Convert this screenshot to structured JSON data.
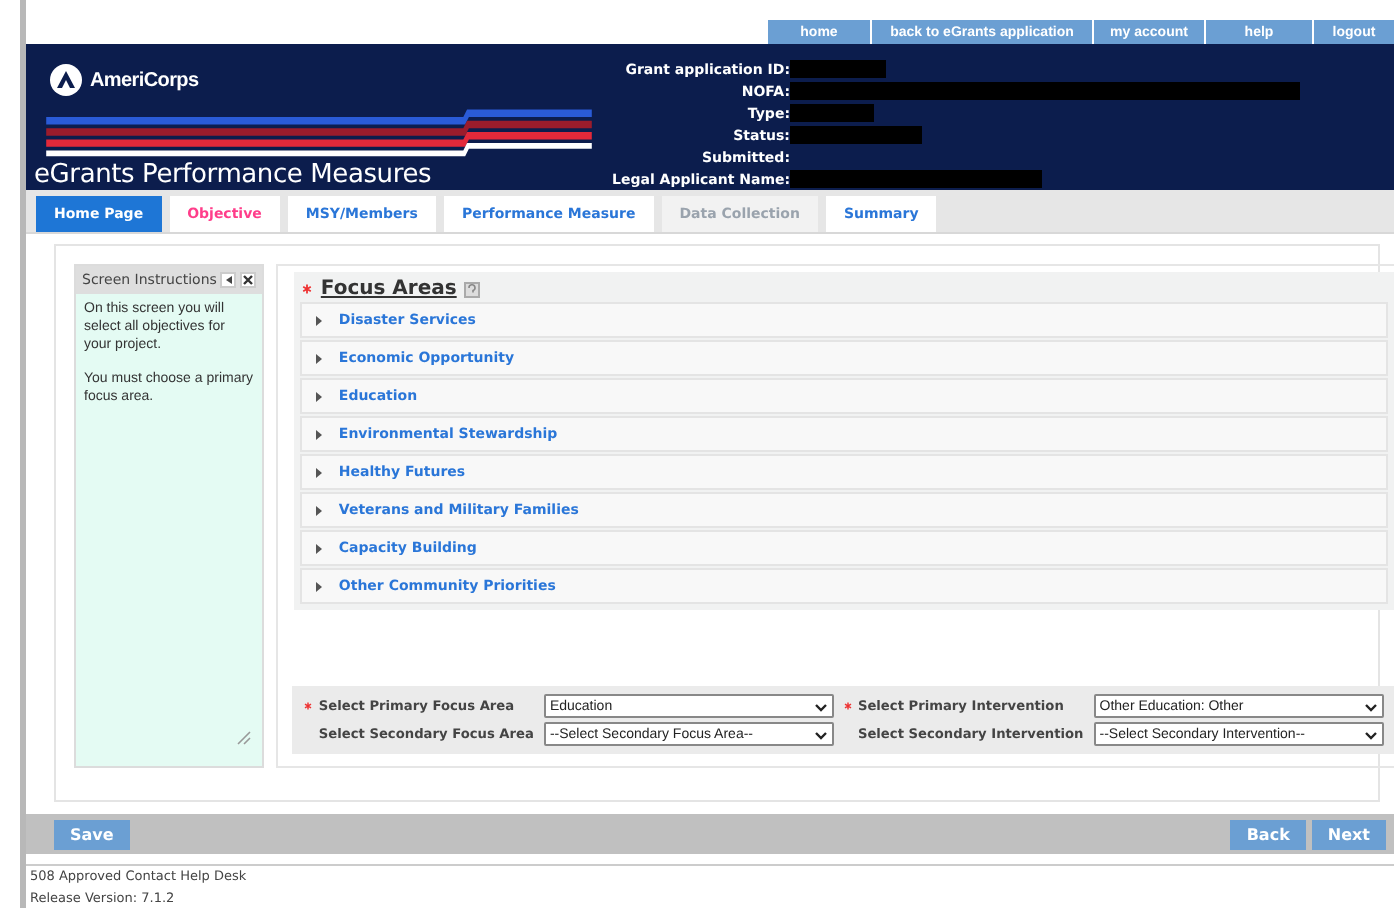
{
  "top_nav": [
    "home",
    "back to eGrants application",
    "my account",
    "help",
    "logout"
  ],
  "header": {
    "logo": "AmeriCorps",
    "title": "eGrants Performance Measures",
    "fields": [
      {
        "label": "Grant application ID:",
        "redacted": true
      },
      {
        "label": "NOFA:",
        "redacted": true
      },
      {
        "label": "Type:",
        "redacted": true
      },
      {
        "label": "Status:",
        "redacted": true
      },
      {
        "label": "Submitted:",
        "redacted": false
      },
      {
        "label": "Legal Applicant Name:",
        "redacted": true
      }
    ]
  },
  "tabs": [
    {
      "label": "Home Page",
      "kind": "home"
    },
    {
      "label": "Objective",
      "kind": "current"
    },
    {
      "label": "MSY/Members",
      "kind": "link"
    },
    {
      "label": "Performance Measure",
      "kind": "link"
    },
    {
      "label": "Data Collection",
      "kind": "disabled"
    },
    {
      "label": "Summary",
      "kind": "link"
    }
  ],
  "instructions": {
    "title": "Screen Instructions",
    "paragraphs": [
      "On this screen you will select all objectives for your project.",
      "You must choose a primary focus area."
    ]
  },
  "focus_areas": {
    "title": "Focus Areas",
    "required": true,
    "items": [
      {
        "label": "Disaster Services",
        "expanded": false
      },
      {
        "label": "Economic Opportunity",
        "expanded": false
      },
      {
        "label": "Education",
        "expanded": false
      },
      {
        "label": "Environmental Stewardship",
        "expanded": false
      },
      {
        "label": "Healthy Futures",
        "expanded": false
      },
      {
        "label": "Veterans and Military Families",
        "expanded": false
      },
      {
        "label": "Capacity Building",
        "expanded": false
      },
      {
        "label": "Other Community Priorities",
        "expanded": false
      }
    ]
  },
  "selections": [
    {
      "label": "Select Primary Focus Area",
      "required": true,
      "value": "Education"
    },
    {
      "label": "Select Primary Intervention",
      "required": true,
      "value": "Other Education: Other"
    },
    {
      "label": "Select Secondary Focus Area",
      "required": false,
      "value": "--Select Secondary Focus Area--"
    },
    {
      "label": "Select Secondary Intervention",
      "required": false,
      "value": "--Select Secondary Intervention--"
    }
  ],
  "buttons_left": [
    "Save"
  ],
  "buttons_right": [
    "Back",
    "Next"
  ],
  "footer": [
    "508 Approved Contact Help Desk",
    "Release Version: 7.1.2"
  ]
}
